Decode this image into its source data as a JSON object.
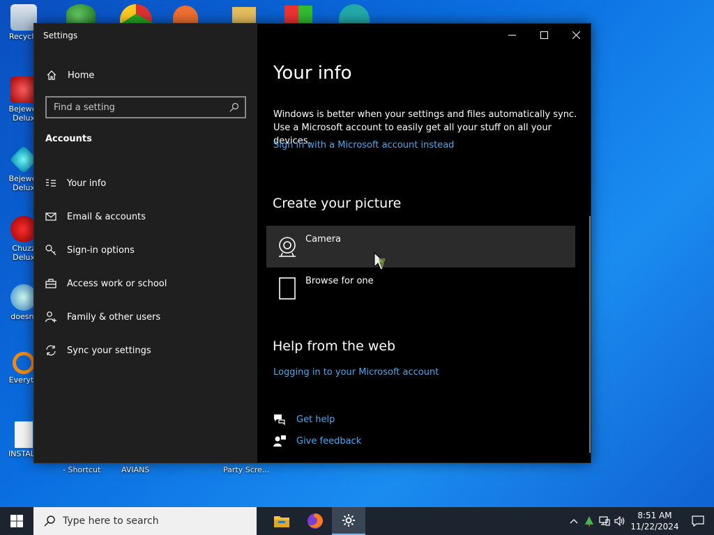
{
  "desktop": {
    "icons": [
      {
        "label": "Recycle"
      },
      {
        "label": "Bejewel Delux"
      },
      {
        "label": "Bejewel Delux"
      },
      {
        "label": "Chuzz Delux"
      },
      {
        "label": "doesnt"
      },
      {
        "label": "Everyth"
      },
      {
        "label": "INSTALL"
      }
    ],
    "bottom_labels": [
      "- Shortcut",
      "AVIANS",
      "Party Scre..."
    ]
  },
  "window": {
    "title": "Settings",
    "home_label": "Home",
    "search_placeholder": "Find a setting",
    "section": "Accounts",
    "nav": [
      {
        "label": "Your info",
        "icon": "person-card-icon"
      },
      {
        "label": "Email & accounts",
        "icon": "mail-icon"
      },
      {
        "label": "Sign-in options",
        "icon": "key-icon"
      },
      {
        "label": "Access work or school",
        "icon": "briefcase-icon"
      },
      {
        "label": "Family & other users",
        "icon": "person-add-icon"
      },
      {
        "label": "Sync your settings",
        "icon": "sync-icon"
      }
    ]
  },
  "content": {
    "title": "Your info",
    "description": "Windows is better when your settings and files automatically sync. Use a Microsoft account to easily get all your stuff on all your devices.",
    "signin_link": "Sign in with a Microsoft account instead",
    "picture_heading": "Create your picture",
    "picture_options": [
      {
        "label": "Camera",
        "icon": "camera-icon"
      },
      {
        "label": "Browse for one",
        "icon": "file-icon"
      }
    ],
    "help_heading": "Help from the web",
    "help_link": "Logging in to your Microsoft account",
    "get_help": "Get help",
    "give_feedback": "Give feedback"
  },
  "taskbar": {
    "search_placeholder": "Type here to search",
    "time": "8:51 AM",
    "date": "11/22/2024"
  },
  "colors": {
    "link": "#4aa8f0",
    "sidebar_bg": "#1f1f1f",
    "content_bg": "#000000",
    "hover_bg": "#2b2b2b"
  }
}
